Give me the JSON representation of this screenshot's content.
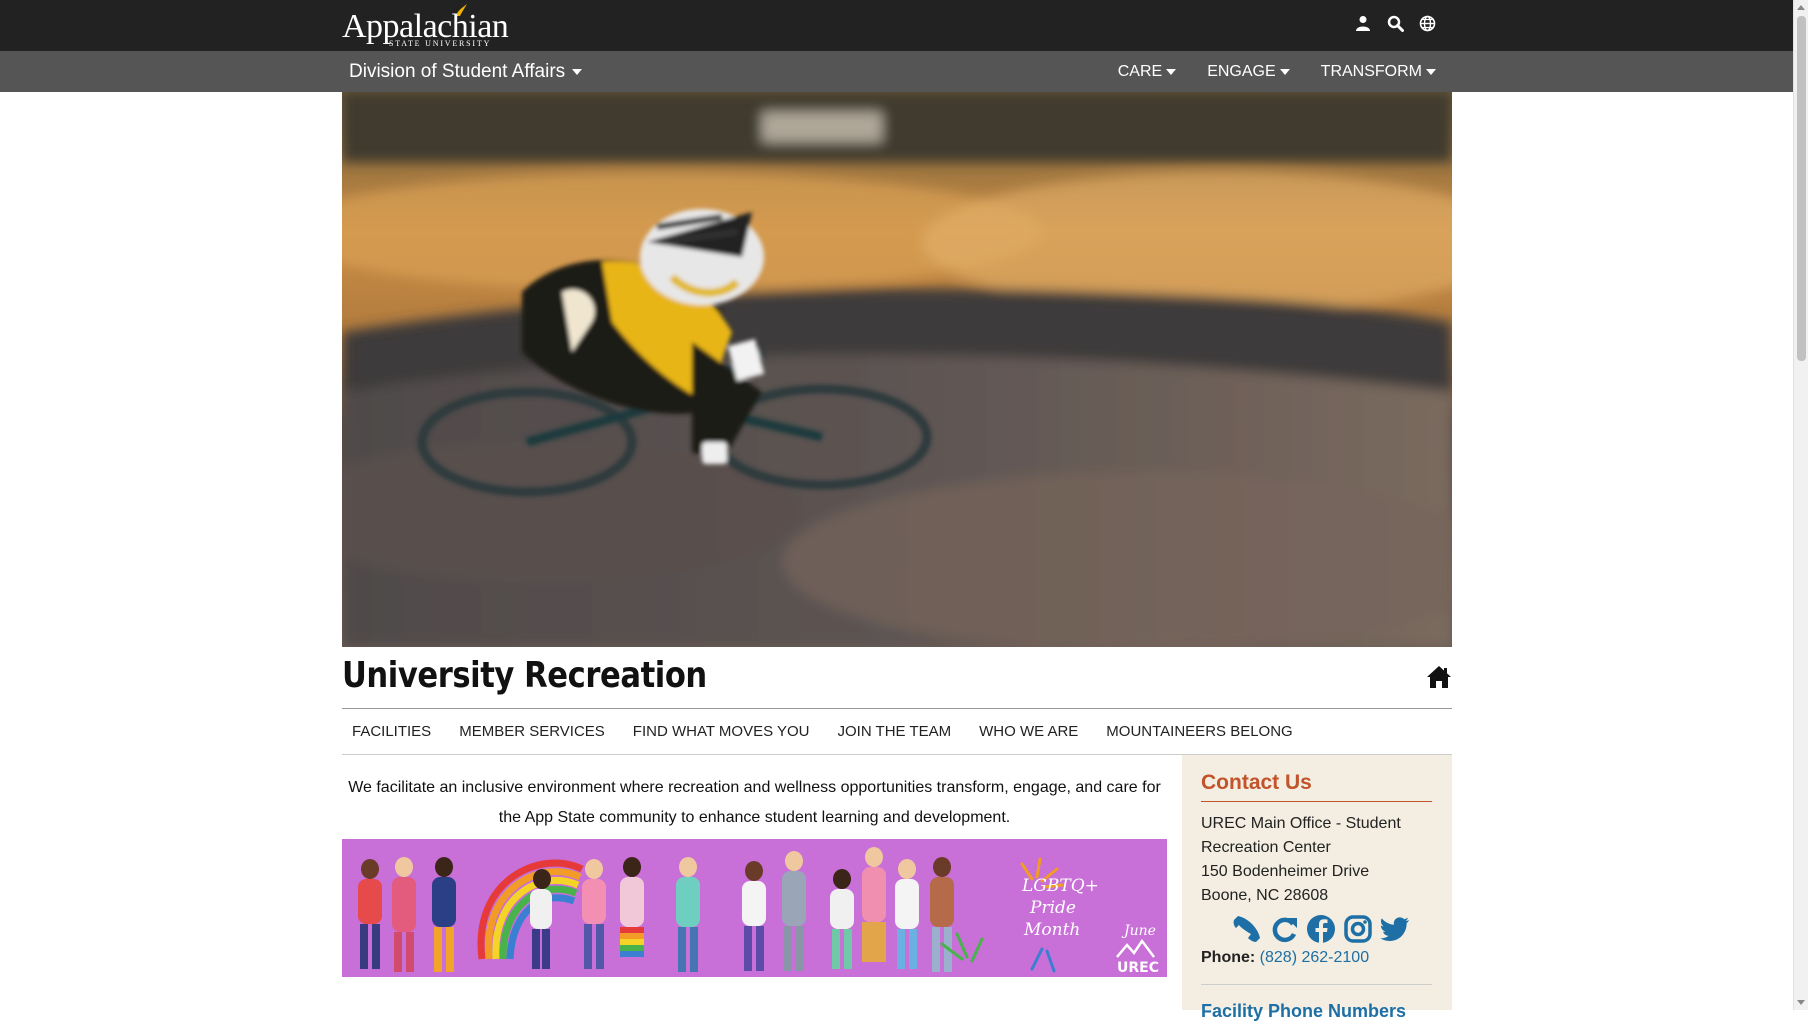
{
  "header": {
    "logo_word": "Appalachian",
    "logo_sub": "STATE UNIVERSITY",
    "icons": [
      "user-icon",
      "search-icon",
      "globe-icon"
    ]
  },
  "navbar": {
    "division_label": "Division of Student Affairs",
    "items": [
      {
        "label": "CARE"
      },
      {
        "label": "ENGAGE"
      },
      {
        "label": "TRANSFORM"
      }
    ]
  },
  "site": {
    "title": "University Recreation"
  },
  "subnav": {
    "items": [
      {
        "label": "FACILITIES"
      },
      {
        "label": "MEMBER SERVICES"
      },
      {
        "label": "FIND WHAT MOVES YOU"
      },
      {
        "label": "JOIN THE TEAM"
      },
      {
        "label": "WHO WE ARE"
      },
      {
        "label": "MOUNTAINEERS BELONG"
      }
    ]
  },
  "main": {
    "mission": "We facilitate an inclusive environment where recreation and wellness opportunities transform, engage, and care for the App State community to enhance student learning and development.",
    "banner": {
      "headline": "LGBTQ+ Pride Month",
      "month": "June",
      "logo": "UREC"
    }
  },
  "sidebar": {
    "contact_heading": "Contact Us",
    "address_line1": "UREC Main Office - Student",
    "address_line2": "Recreation Center",
    "address_line3": "150 Bodenheimer Drive",
    "address_line4": "Boone, NC 28608",
    "social_icons": [
      "phone-icon",
      "refresh-icon",
      "facebook-icon",
      "instagram-icon",
      "twitter-icon"
    ],
    "phone_label": "Phone:",
    "phone_number": "(828) 262-2100",
    "facility_heading": "Facility Phone Numbers"
  },
  "colors": {
    "topbar": "#222222",
    "navbar": "#555555",
    "accent": "#c2532b",
    "link": "#1d6fa5",
    "sidebar_bg": "#f3eee1",
    "banner_bg": "#c86fd8"
  }
}
